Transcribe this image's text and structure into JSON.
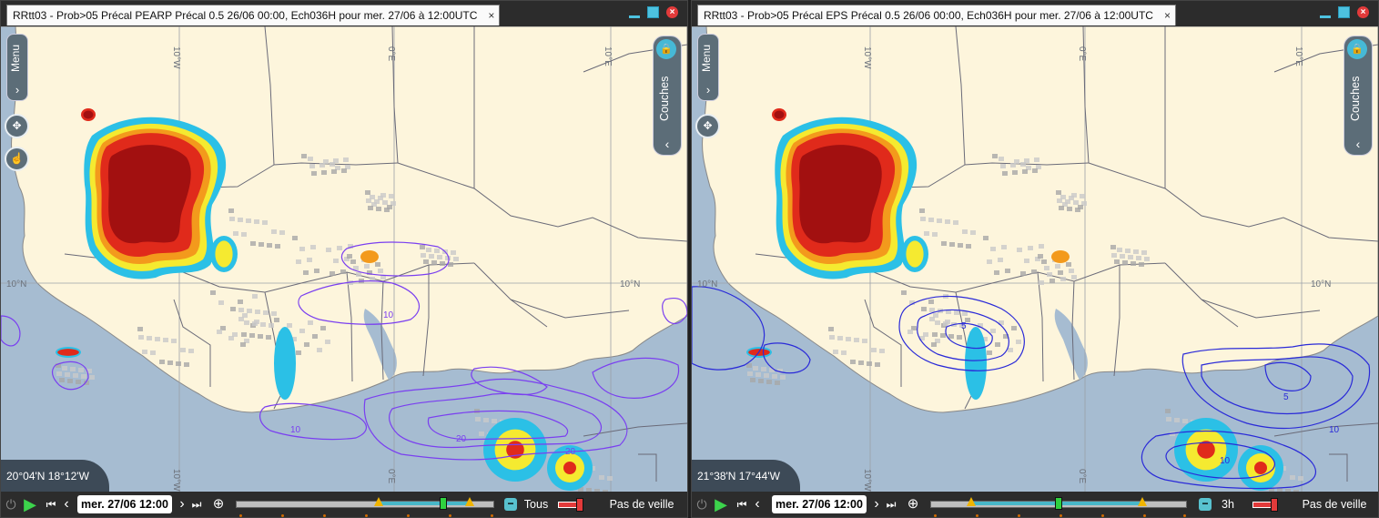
{
  "panels": [
    {
      "title": "RRtt03 - Prob>05 Précal PEARP Précal 0.5 26/06 00:00, Ech036H pour mer. 27/06 à 12:00UTC",
      "coords": "20°04'N 18°12'W",
      "menu_label": "Menu",
      "layers_label": "Couches",
      "date": "mer. 27/06 12:00",
      "step": "Tous",
      "veille": "Pas de veille",
      "contour_color": "#7a3ff0",
      "contour_labels": [
        "10",
        "10",
        "20",
        "20"
      ]
    },
    {
      "title": "RRtt03 - Prob>05 Précal EPS Précal 0.5 26/06 00:00, Ech036H pour mer. 27/06 à 12:00UTC",
      "coords": "21°38'N 17°44'W",
      "menu_label": "Menu",
      "layers_label": "Couches",
      "date": "mer. 27/06 12:00",
      "step": "3h",
      "veille": "Pas de veille",
      "contour_color": "#2a2ad8",
      "contour_labels": [
        "5",
        "5",
        "10",
        "10"
      ]
    }
  ],
  "map": {
    "grid_labels": [
      "10°W",
      "0°E",
      "10°E",
      "10°N",
      "10°W",
      "0°E",
      "10°N"
    ],
    "land_color": "#fdf5dc",
    "sea_color": "#a6bcd1"
  },
  "icons": {
    "tab_close": "×",
    "close": "×",
    "chevron_right": "›",
    "chevron_left": "‹",
    "lock": "🔒",
    "pan": "✥",
    "hand": "☝",
    "power": "⏻",
    "play": "▶",
    "first": "⏮",
    "prev": "‹",
    "next": "›",
    "last": "⏭",
    "zoom": "⊕",
    "minus": "−"
  }
}
